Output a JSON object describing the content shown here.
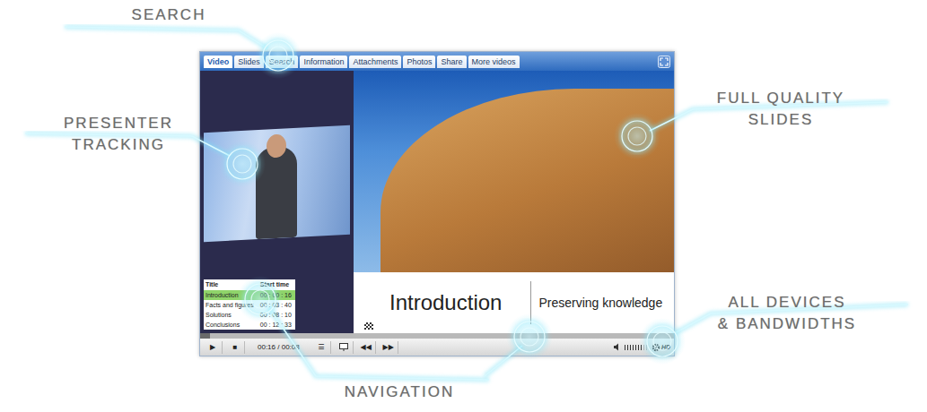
{
  "callouts": [
    {
      "lines": [
        "SEARCH"
      ]
    },
    {
      "lines": [
        "PRESENTER",
        "TRACKING"
      ]
    },
    {
      "lines": [
        "FULL QUALITY",
        "SLIDES"
      ]
    },
    {
      "lines": [
        "ALL DEVICES",
        "& BANDWIDTHS"
      ]
    },
    {
      "lines": [
        "NAVIGATION"
      ]
    }
  ],
  "player": {
    "tabs": [
      {
        "label": "Video",
        "selected": true
      },
      {
        "label": "Slides",
        "selected": false
      },
      {
        "label": "Search",
        "selected": false
      },
      {
        "label": "Information",
        "selected": false
      },
      {
        "label": "Attachments",
        "selected": false
      },
      {
        "label": "Photos",
        "selected": false
      },
      {
        "label": "Share",
        "selected": false
      },
      {
        "label": "More videos",
        "selected": false
      }
    ],
    "chapters": {
      "columns": [
        "Title",
        "Start time"
      ],
      "rows": [
        {
          "title": "Introduction",
          "start": "00 : 00 : 16",
          "selected": true
        },
        {
          "title": "Facts and figures",
          "start": "00 : 03 : 40",
          "selected": false
        },
        {
          "title": "Solutions",
          "start": "00 : 08 : 10",
          "selected": false
        },
        {
          "title": "Conclusions",
          "start": "00 : 12 : 33",
          "selected": false
        }
      ]
    },
    "slide": {
      "title": "Introduction",
      "subtitle": "Preserving knowledge"
    },
    "controls": {
      "play": "▶",
      "stop": "■",
      "time": "00:16 / 00:08",
      "list": "☰",
      "rewind": "◀◀",
      "forward": "▶▶",
      "progress": {
        "level": 0.02
      },
      "volume": {
        "level": 0.8
      },
      "quality": "HD"
    }
  }
}
